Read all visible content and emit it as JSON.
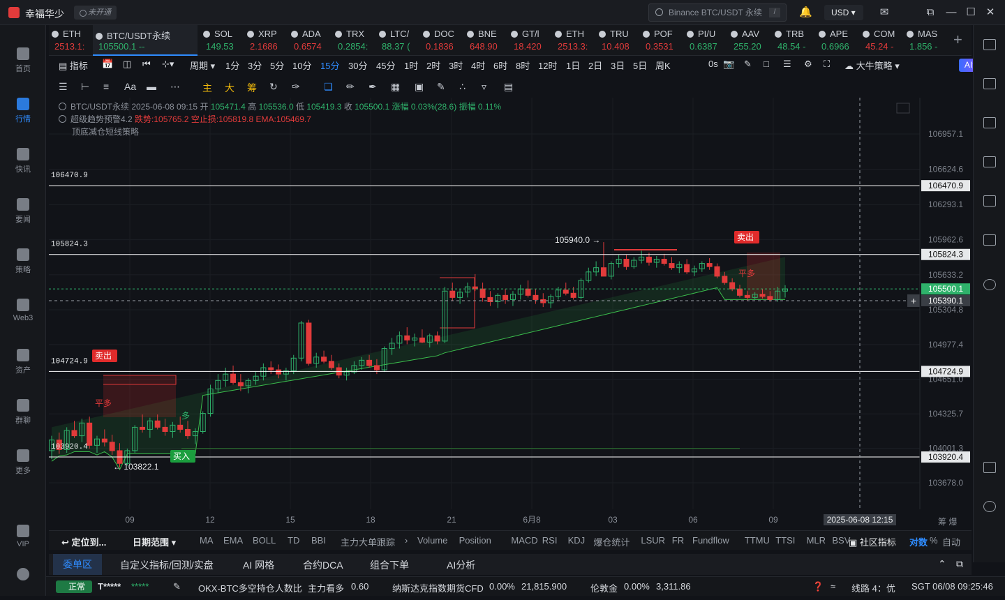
{
  "app": {
    "name": "幸福华少",
    "badge": "未开通"
  },
  "search": {
    "placeholder": "Binance BTC/USDT 永续",
    "shortcut": "/"
  },
  "currency": "USD",
  "left_nav": [
    {
      "label": "首页",
      "icon": "home-icon"
    },
    {
      "label": "行情",
      "icon": "market-chart-icon",
      "active": true
    },
    {
      "label": "快讯",
      "icon": "news-icon"
    },
    {
      "label": "要闻",
      "icon": "headline-icon"
    },
    {
      "label": "策略",
      "icon": "strategy-icon"
    },
    {
      "label": "Web3",
      "icon": "web3-icon"
    },
    {
      "label": "资产",
      "icon": "wallet-icon"
    },
    {
      "label": "群聊",
      "icon": "chat-icon"
    },
    {
      "label": "更多",
      "icon": "more-grid-icon"
    },
    {
      "label": "VIP",
      "icon": "vip-diamond-icon"
    }
  ],
  "tickers": [
    {
      "sym": "ETH",
      "price": "2513.1:",
      "dir": "down"
    },
    {
      "sym": "BTC/USDT永续",
      "price": "105500.1 --",
      "dir": "up",
      "active": true
    },
    {
      "sym": "SOL",
      "price": "149.53",
      "dir": "up"
    },
    {
      "sym": "XRP",
      "price": "2.1686",
      "dir": "down"
    },
    {
      "sym": "ADA",
      "price": "0.6574",
      "dir": "down"
    },
    {
      "sym": "TRX",
      "price": "0.2854:",
      "dir": "up"
    },
    {
      "sym": "LTC/",
      "price": "88.37 (",
      "dir": "up"
    },
    {
      "sym": "DOC",
      "price": "0.1836",
      "dir": "down"
    },
    {
      "sym": "BNE",
      "price": "648.90",
      "dir": "down"
    },
    {
      "sym": "GT/l",
      "price": "18.420",
      "dir": "down"
    },
    {
      "sym": "ETH",
      "price": "2513.3:",
      "dir": "down"
    },
    {
      "sym": "TRU",
      "price": "10.408",
      "dir": "down"
    },
    {
      "sym": "POF",
      "price": "0.3531",
      "dir": "down"
    },
    {
      "sym": "PI/U",
      "price": "0.6387",
      "dir": "up"
    },
    {
      "sym": "AAV",
      "price": "255.20",
      "dir": "up"
    },
    {
      "sym": "TRB",
      "price": "48.54 -",
      "dir": "up"
    },
    {
      "sym": "APE",
      "price": "0.6966",
      "dir": "up"
    },
    {
      "sym": "COM",
      "price": "45.24 -",
      "dir": "down"
    },
    {
      "sym": "MAS",
      "price": "1.856 -",
      "dir": "up"
    }
  ],
  "toolbar": {
    "indicator": "指标",
    "period": "周期",
    "intervals": [
      "1分",
      "3分",
      "5分",
      "10分",
      "15分",
      "30分",
      "45分",
      "1时",
      "2时",
      "3时",
      "4时",
      "6时",
      "8时",
      "12时",
      "1日",
      "2日",
      "3日",
      "5日",
      "周K"
    ],
    "active_interval": "15分",
    "countdown": "0s",
    "strategy": "大牛策略",
    "ai": "AI解读"
  },
  "draw_tools": {
    "main": "主",
    "big": "大",
    "chip": "筹"
  },
  "legend": {
    "line1_prefix": "BTC/USDT永续 2025-06-08 09:15",
    "open_label": "开",
    "open": "105471.4",
    "high_label": "高",
    "high": "105536.0",
    "low_label": "低",
    "low": "105419.3",
    "close_label": "收",
    "close": "105500.1",
    "change": "涨幅 0.03%(28.6)",
    "amp": "振幅 0.11%",
    "line2_name": "超级趋势预警4.2",
    "line2_a": "跌势:105765.2",
    "line2_b": "空止损:105819.8",
    "line2_c": "EMA:105469.7",
    "line3": "顶底减仓短线策略"
  },
  "chart_data": {
    "type": "candlestick",
    "symbol": "BTC/USDT永续",
    "interval": "15分",
    "yticks": [
      "106957.1",
      "106624.6",
      "106293.1",
      "105962.6",
      "105633.2",
      "105304.8",
      "104977.4",
      "104651.0",
      "104325.7",
      "104001.3",
      "103678.0"
    ],
    "xticks": [
      "09",
      "12",
      "15",
      "18",
      "21",
      "6月8",
      "03",
      "06",
      "09"
    ],
    "crosshair_time": "2025-06-08 12:15",
    "crosshair_price": "105390.1",
    "last_price": "105500.1",
    "hlines": [
      {
        "value": "106470.9",
        "color": "#ffffff"
      },
      {
        "value": "105824.3",
        "color": "#ffffff"
      },
      {
        "value": "104724.9",
        "color": "#ffffff"
      },
      {
        "value": "103920.4",
        "color": "#ffffff"
      }
    ],
    "annotations": [
      {
        "text": "105940.0 →"
      },
      {
        "text": "← 103822.1"
      },
      {
        "text": "卖出",
        "kind": "sell"
      },
      {
        "text": "卖出",
        "kind": "sell"
      },
      {
        "text": "买入",
        "kind": "buy"
      },
      {
        "text": "平多"
      },
      {
        "text": "平多"
      },
      {
        "text": "多"
      }
    ],
    "candles": [
      [
        103980,
        104120,
        103900,
        104080
      ],
      [
        104080,
        104150,
        103950,
        103990
      ],
      [
        103990,
        104200,
        103960,
        104170
      ],
      [
        104170,
        104260,
        104100,
        104120
      ],
      [
        104120,
        104280,
        104060,
        104240
      ],
      [
        104240,
        104300,
        104000,
        104030
      ],
      [
        104030,
        104120,
        103960,
        104090
      ],
      [
        104090,
        104180,
        104020,
        104060
      ],
      [
        104060,
        104130,
        103940,
        103980
      ],
      [
        103980,
        104050,
        103822,
        103860
      ],
      [
        103860,
        104000,
        103840,
        103980
      ],
      [
        103980,
        104220,
        103960,
        104200
      ],
      [
        104200,
        104320,
        104150,
        104180
      ],
      [
        104180,
        104290,
        104100,
        104260
      ],
      [
        104260,
        104320,
        104180,
        104200
      ],
      [
        104200,
        104280,
        104120,
        104160
      ],
      [
        104160,
        104250,
        104100,
        104220
      ],
      [
        104220,
        104300,
        104150,
        104180
      ],
      [
        104180,
        104260,
        104090,
        104120
      ],
      [
        104120,
        104190,
        104040,
        104160
      ],
      [
        104160,
        104350,
        104140,
        104330
      ],
      [
        104330,
        104600,
        104300,
        104560
      ],
      [
        104560,
        104700,
        104520,
        104640
      ],
      [
        104640,
        104760,
        104580,
        104700
      ],
      [
        104700,
        104780,
        104600,
        104620
      ],
      [
        104620,
        104700,
        104540,
        104590
      ],
      [
        104590,
        104660,
        104520,
        104640
      ],
      [
        104640,
        104720,
        104600,
        104680
      ],
      [
        104680,
        104800,
        104640,
        104760
      ],
      [
        104760,
        104820,
        104700,
        104740
      ],
      [
        104740,
        104790,
        104660,
        104700
      ],
      [
        104700,
        104760,
        104640,
        104730
      ],
      [
        104730,
        104880,
        104700,
        104850
      ],
      [
        104850,
        105200,
        104820,
        105180
      ],
      [
        105180,
        105210,
        104780,
        104800
      ],
      [
        104800,
        104900,
        104760,
        104860
      ],
      [
        104860,
        104920,
        104800,
        104820
      ],
      [
        104820,
        104880,
        104740,
        104760
      ],
      [
        104760,
        104800,
        104660,
        104690
      ],
      [
        104690,
        104760,
        104640,
        104720
      ],
      [
        104720,
        104820,
        104700,
        104780
      ],
      [
        104780,
        104860,
        104740,
        104830
      ],
      [
        104830,
        104880,
        104760,
        104780
      ],
      [
        104780,
        104840,
        104700,
        104740
      ],
      [
        104740,
        104960,
        104720,
        104940
      ],
      [
        104940,
        105040,
        104880,
        104990
      ],
      [
        104990,
        105100,
        104940,
        105060
      ],
      [
        105060,
        105140,
        104980,
        105020
      ],
      [
        105020,
        105080,
        104960,
        105040
      ],
      [
        105040,
        105120,
        104990,
        105000
      ],
      [
        105000,
        105080,
        104950,
        105060
      ],
      [
        105060,
        105100,
        104980,
        105010
      ],
      [
        105010,
        105520,
        104990,
        105480
      ],
      [
        105480,
        105560,
        105390,
        105420
      ],
      [
        105420,
        105500,
        105360,
        105470
      ],
      [
        105470,
        105560,
        105420,
        105520
      ],
      [
        105520,
        105640,
        105480,
        105500
      ],
      [
        105500,
        105560,
        105380,
        105420
      ],
      [
        105420,
        105480,
        105340,
        105380
      ],
      [
        105380,
        105460,
        105320,
        105440
      ],
      [
        105440,
        105500,
        105360,
        105400
      ],
      [
        105400,
        105480,
        105340,
        105450
      ],
      [
        105450,
        105540,
        105400,
        105500
      ],
      [
        105500,
        105580,
        105420,
        105440
      ],
      [
        105440,
        105500,
        105360,
        105400
      ],
      [
        105400,
        105460,
        105330,
        105370
      ],
      [
        105370,
        105450,
        105320,
        105430
      ],
      [
        105430,
        105520,
        105400,
        105490
      ],
      [
        105490,
        105560,
        105440,
        105460
      ],
      [
        105460,
        105520,
        105400,
        105420
      ],
      [
        105420,
        105600,
        105400,
        105580
      ],
      [
        105580,
        105700,
        105560,
        105660
      ],
      [
        105660,
        105760,
        105620,
        105700
      ],
      [
        105700,
        105940,
        105680,
        105620
      ],
      [
        105620,
        105760,
        105590,
        105740
      ],
      [
        105740,
        105820,
        105700,
        105780
      ],
      [
        105780,
        105820,
        105680,
        105710
      ],
      [
        105710,
        105800,
        105690,
        105770
      ],
      [
        105770,
        105860,
        105740,
        105800
      ],
      [
        105800,
        105840,
        105720,
        105750
      ],
      [
        105750,
        105810,
        105700,
        105780
      ],
      [
        105780,
        105830,
        105720,
        105740
      ],
      [
        105740,
        105800,
        105680,
        105700
      ],
      [
        105700,
        105760,
        105650,
        105730
      ],
      [
        105730,
        105780,
        105640,
        105660
      ],
      [
        105660,
        105720,
        105620,
        105690
      ],
      [
        105690,
        105760,
        105660,
        105740
      ],
      [
        105740,
        105790,
        105680,
        105710
      ],
      [
        105710,
        105740,
        105600,
        105620
      ],
      [
        105620,
        105660,
        105540,
        105560
      ],
      [
        105560,
        105600,
        105480,
        105500
      ],
      [
        105500,
        105540,
        105420,
        105440
      ],
      [
        105440,
        105480,
        105390,
        105420
      ],
      [
        105420,
        105470,
        105400,
        105450
      ],
      [
        105450,
        105500,
        105410,
        105430
      ],
      [
        105430,
        105480,
        105380,
        105400
      ],
      [
        105400,
        105520,
        105380,
        105480
      ],
      [
        105480,
        105536,
        105419,
        105500
      ]
    ]
  },
  "bottom_tools": {
    "locate": "定位到...",
    "range": "日期范围",
    "indicators": [
      "MA",
      "EMA",
      "BOLL",
      "TD",
      "BBI",
      "主力大单跟踪"
    ],
    "sub_indicators": [
      "Volume",
      "Position",
      "MACD",
      "RSI",
      "KDJ",
      "爆仓统计",
      "LSUR",
      "FR",
      "Fundflow",
      "TTMU",
      "TTSI",
      "MLR",
      "BSV"
    ],
    "community": "社区指标",
    "log": "对数",
    "pct": "%",
    "auto": "自动"
  },
  "panel_tabs": [
    "委单区",
    "自定义指标/回测/实盘",
    "AI 网格",
    "合约DCA",
    "组合下单",
    "AI分析"
  ],
  "status": {
    "normal": "正常",
    "user": "T*****",
    "masked": "*****",
    "item1_name": "OKX-BTC多空持仓人数比",
    "item1_tag": "主力看多",
    "item1_val": "0.60",
    "item2_name": "纳斯达克指数期货CFD",
    "item2_pct": "0.00%",
    "item2_val": "21,815.900",
    "item3_name": "伦敦金",
    "item3_pct": "0.00%",
    "item3_val": "3,311.86",
    "line": "线路 4：优",
    "time": "SGT 06/08 09:25:46"
  }
}
